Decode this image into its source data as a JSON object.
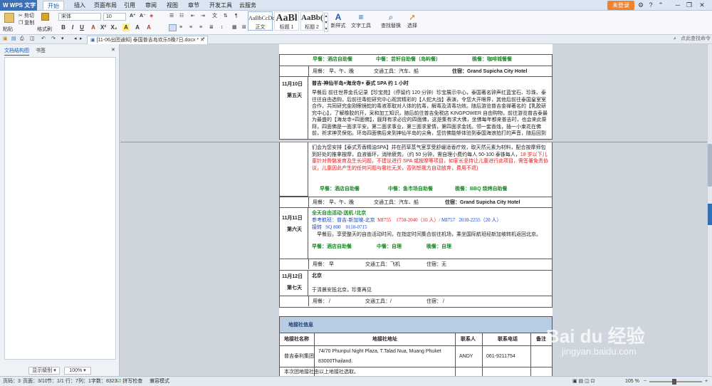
{
  "app": {
    "name": "WPS 文字"
  },
  "menu": [
    "开始",
    "插入",
    "页面布局",
    "引用",
    "审阅",
    "视图",
    "章节",
    "开发工具",
    "云服务"
  ],
  "login": "未登录",
  "ribbon": {
    "paste": "粘贴",
    "cut": "剪切",
    "copy": "复制",
    "format_painter": "格式刷",
    "font": "宋体",
    "font_size": "10",
    "styles": [
      {
        "sample": "AaBbCcDd",
        "name": "正文"
      },
      {
        "sample": "AaBl",
        "name": "标题 1"
      },
      {
        "sample": "AaBb(",
        "name": "标题 2"
      }
    ],
    "new_style": "新样式",
    "text_tools": "文字工具",
    "find_replace": "查找替换",
    "select": "选择"
  },
  "doctab": "[11-06出团通知] 泰国普吉岛欢乐5晚7日.docx *",
  "nav": {
    "tab1": "文档结构图",
    "tab2": "书签",
    "display_level": "显示级别",
    "zoom": "100%",
    "search_hint": "点此查找命令"
  },
  "doc": {
    "day4_meals": {
      "breakfast": "早餐：酒店自助餐",
      "lunch": "中餐：芸轩自助餐（岛屿餐）",
      "dinner": "晚餐：咖啡城餐餐"
    },
    "day4_info": {
      "meals": "用餐： 早、午、晚",
      "transport": "交通工具：汽车、船",
      "hotel": "住宿：Grand Supicha City Hotel"
    },
    "day5": {
      "date": "11月10日",
      "day": "第五天",
      "title": "普吉-神仙半岛+海龙寺+ 泰式 SPA 约 1 小时",
      "body1": "早餐后 前往世界金氏记录【珍宝苑】（停留约 120 分钟）珍宝展示中心，泰国著名钟声红蓝宝石、珍珠、泰往往自由选购，后前往毒蛇研究中心观赏精彩的【人蛇大战】表演，令您大开眼界，其他后前往泰国皇室室合作，共同研究金刚眼镜蛇的毒液萃取对人体的抗毒，解毒及清毒功效。随后游览普吉金禅著名的【乳胶研究中心】，了解橡胶的开，采和加工知识。随后前往普吉免税店 KINGPOWER 自由购物，前往游览普吉泰最为最盛的【海龙寺+四面佛】，膜拜有求必应的四面佛，这是集有求大佛，坐佛每年都来普吉时，也会来此祭拜，四面佛是一面求平安，第二面求事业，第三面求爱情，第四面求金钱。领一套香烛，插一小束花在佛前，祈求神灵保佑。环岛四面佛后来到神仙半岛的尖角，您仿佛能够体验到泰国海浪拍打的声音，随后回到",
      "body2": "们会为您安排【泰式芳香精油SPA】并在药草蒸气室享受舒缓适香疗效，取天然元素为材料，配合按摩师包到好处的推拿按摩，血液循环，消除疲劳。（约 50 分钟，需自理小费约每人 50-100 泰铢每人，",
      "body2_red": "18 岁以下儿童针对骨骼发育及生长问题，不建议进行 SPA 或按摩等项目，如家长坚持让儿童进行此项目，需签署免责协议，儿童因此产生的任何问题与我社无关，否则恕我方自动放弃，费用不退)",
      "meals": {
        "breakfast": "早餐：酒店自助餐",
        "lunch": "中餐：鱼市场自助餐",
        "dinner": "晚餐：BBQ 烧烤自助餐"
      },
      "info": {
        "meals": "用餐： 早、午、晚",
        "transport": "交通工具：汽车、船",
        "hotel": "住宿：Grand Supicha City Hotel"
      }
    },
    "day6": {
      "date": "11月11日",
      "day": "第六天",
      "title": "全天自由活动-送机 /北京",
      "flight_ref": "参考航班：普吉-新加坡-北京",
      "flight1": "MI755",
      "flight1_time": "1750-2040（10 人）/",
      "flight2": "MI757",
      "flight2_time": "2010-2255（20 人）",
      "transfer": "接转",
      "transfer_flight": "SQ 800",
      "transfer_time": "0110-0715",
      "body": "早餐后，享受整天的自由活动时间，在指定时间集合前往机场，乘坐国际航班经新加坡转机返回北京。",
      "meals": {
        "breakfast": "早餐：酒店自助餐",
        "lunch": "中餐：自理",
        "dinner": "晚餐：自理"
      },
      "info": {
        "meals": "用餐： 早",
        "transport": "交通工具：飞机",
        "hotel": "住宿：无"
      }
    },
    "day7": {
      "date": "11月12日",
      "day": "第七天",
      "title": "北京",
      "body": "于清晨安抵北京，珍重再见",
      "info": {
        "meals": "用餐： /",
        "transport": "交通工具：/",
        "hotel": "住宿： /"
      }
    },
    "agency": {
      "title": "地接社信息",
      "headers": [
        "地接社名称",
        "地接社地址",
        "联系人",
        "联系电话",
        "备注"
      ],
      "name": "普吉泰利集团",
      "address_line1": "74/70 Phunpul Night Plaza, T.Talad Nua, Muang Phuket",
      "address_line2": "83000Thailand.",
      "contact": "ANDY",
      "phone": "061-9211754",
      "note": "",
      "footnote": "本次团地接社由以上地接社选取。"
    }
  },
  "status": {
    "page": "页码：3",
    "pages": "页面：3/10",
    "section": "节：1/1",
    "row": "行：7",
    "col": "列：1",
    "words": "字数：8323",
    "spell": "拼写检查",
    "compat": "兼容模式",
    "zoom": "105 %"
  },
  "watermark": {
    "brand": "Bai du 经验",
    "url": "jingyan.baidu.com"
  }
}
